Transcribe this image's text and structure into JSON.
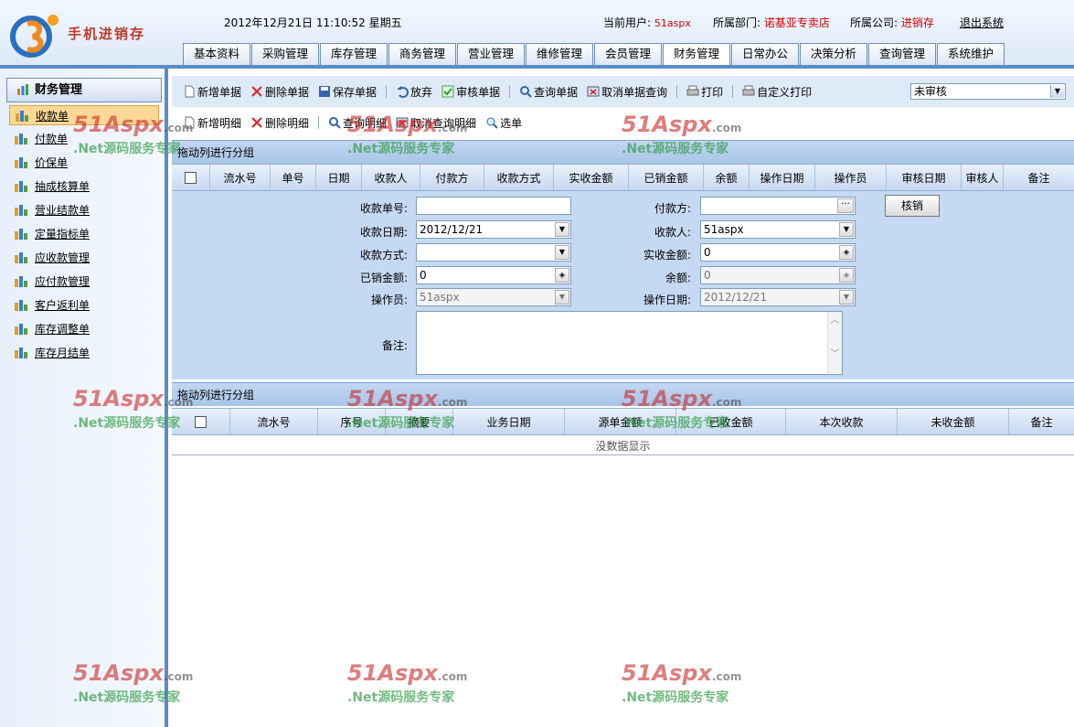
{
  "header": {
    "logo_text": "手机进销存",
    "datetime": "2012年12月21日  11:10:52 星期五",
    "user_label": "当前用户:",
    "user_value": "51aspx",
    "dept_label": "所属部门:",
    "dept_value": "诺基亚专卖店",
    "company_label": "所属公司:",
    "company_value": "进销存",
    "logout": "退出系统"
  },
  "nav": {
    "tabs": [
      "基本资料",
      "采购管理",
      "库存管理",
      "商务管理",
      "营业管理",
      "维修管理",
      "会员管理",
      "财务管理",
      "日常办公",
      "决策分析",
      "查询管理",
      "系统维护"
    ],
    "active": "财务管理"
  },
  "sidebar": {
    "title": "财务管理",
    "items": [
      "收款单",
      "付款单",
      "价保单",
      "抽成核算单",
      "营业结款单",
      "定量指标单",
      "应收款管理",
      "应付款管理",
      "客户返利单",
      "库存调整单",
      "库存月结单"
    ],
    "active": "收款单"
  },
  "toolbar1": {
    "buttons": [
      "新增单据",
      "删除单据",
      "保存单据",
      "放弃",
      "审核单据",
      "查询单据",
      "取消单据查询",
      "打印",
      "自定义打印"
    ],
    "status_select": "未审核"
  },
  "toolbar2": {
    "buttons": [
      "新增明细",
      "删除明细",
      "查询明细",
      "取消查询明细",
      "选单"
    ]
  },
  "grid1": {
    "group_hint": "拖动列进行分组",
    "columns": [
      "流水号",
      "单号",
      "日期",
      "收款人",
      "付款方",
      "收款方式",
      "实收金额",
      "已销金额",
      "余额",
      "操作日期",
      "操作员",
      "审核日期",
      "审核人",
      "备注"
    ]
  },
  "form": {
    "receipt_no_label": "收款单号:",
    "receipt_no": "",
    "payer_label": "付款方:",
    "payer": "",
    "receipt_date_label": "收款日期:",
    "receipt_date": "2012/12/21",
    "receiver_label": "收款人:",
    "receiver": "51aspx",
    "method_label": "收款方式:",
    "method": "",
    "actual_amount_label": "实收金额:",
    "actual_amount": "0",
    "written_off_label": "已销金额:",
    "written_off": "0",
    "balance_label": "余额:",
    "balance": "0",
    "operator_label": "操作员:",
    "operator": "51aspx",
    "op_date_label": "操作日期:",
    "op_date": "2012/12/21",
    "remark_label": "备注:",
    "remark": "",
    "verify_button": "核销"
  },
  "grid2": {
    "group_hint": "拖动列进行分组",
    "columns": [
      "流水号",
      "序号",
      "摘要",
      "业务日期",
      "源单金额",
      "已收金额",
      "本次收款",
      "未收金额",
      "备注"
    ],
    "empty_text": "没数据显示"
  },
  "watermark": {
    "line1": "51Aspx",
    "line1_suffix": ".com",
    "line2": ".Net源码服务专家"
  }
}
